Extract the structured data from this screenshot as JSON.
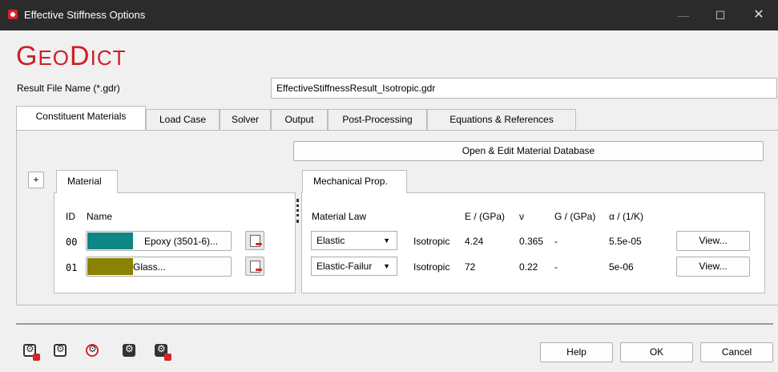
{
  "window": {
    "title": "Effective Stiffness Options",
    "minimize_glyph": "—",
    "maximize_glyph": "☐",
    "close_glyph": "✕"
  },
  "logo": {
    "first_G": "G",
    "eo": "EO",
    "D": "D",
    "ict": "ICT"
  },
  "result_file": {
    "label": "Result File Name (*.gdr)",
    "value": "EffectiveStiffnessResult_Isotropic.gdr"
  },
  "tabs": [
    {
      "label": "Constituent Materials",
      "active": true
    },
    {
      "label": "Load Case"
    },
    {
      "label": "Solver"
    },
    {
      "label": "Output"
    },
    {
      "label": "Post-Processing"
    },
    {
      "label": "Equations & References"
    }
  ],
  "open_db_button": "Open & Edit Material Database",
  "add_button": "+",
  "material_panel": {
    "tab": "Material",
    "header_id": "ID",
    "header_name": "Name",
    "rows": [
      {
        "id": "00",
        "name": "Epoxy (3501-6)...",
        "color": "#0f8585"
      },
      {
        "id": "01",
        "name": "Glass...",
        "color": "#8a8200"
      }
    ]
  },
  "mech_panel": {
    "tab": "Mechanical Prop.",
    "headers": {
      "law": "Material Law",
      "E": "E / (GPa)",
      "nu": "ν",
      "G": "G / (GPa)",
      "alpha": "α / (1/K)"
    },
    "rows": [
      {
        "law": "Elastic",
        "type": "Isotropic",
        "E": "4.24",
        "nu": "0.365",
        "G": "-",
        "alpha": "5.5e-05",
        "view": "View..."
      },
      {
        "law": "Elastic-Failur",
        "type": "Isotropic",
        "E": "72",
        "nu": "0.22",
        "G": "-",
        "alpha": "5e-06",
        "view": "View..."
      }
    ]
  },
  "bottom": {
    "help": "Help",
    "ok": "OK",
    "cancel": "Cancel",
    "tool_icons": [
      "save-settings-icon",
      "load-settings-icon",
      "refresh-settings-icon",
      "edit-settings-icon",
      "save-macro-icon"
    ]
  },
  "colors": {
    "brand_red": "#cc1f28",
    "titlebar": "#2b2b2b"
  }
}
